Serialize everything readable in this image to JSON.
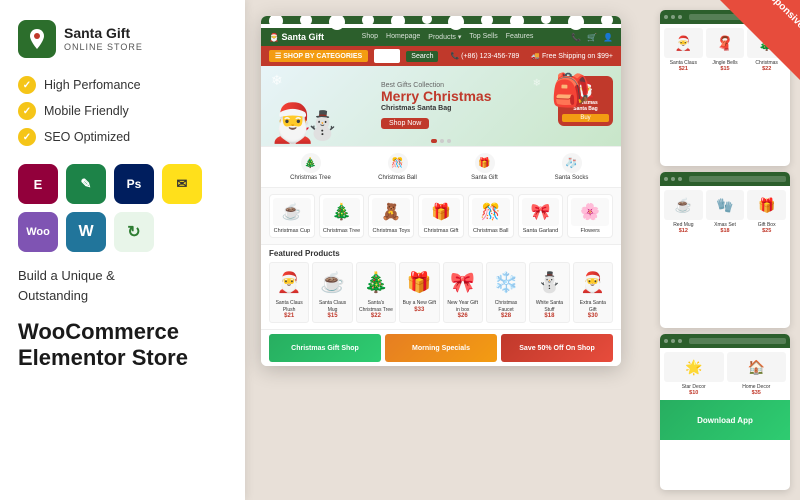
{
  "logo": {
    "title": "Santa Gift",
    "subtitle": "Online Store"
  },
  "features": [
    {
      "label": "High Perfomance"
    },
    {
      "label": "Mobile Friendly"
    },
    {
      "label": "SEO Optimized"
    }
  ],
  "plugins": [
    {
      "name": "elementor",
      "label": "E",
      "class": "pi-elementor"
    },
    {
      "name": "edit",
      "label": "✎",
      "class": "pi-edit"
    },
    {
      "name": "photoshop",
      "label": "Ps",
      "class": "pi-ps"
    },
    {
      "name": "mailchimp",
      "label": "✉",
      "class": "pi-mailchimp"
    },
    {
      "name": "woocommerce",
      "label": "Woo",
      "class": "pi-woo"
    },
    {
      "name": "wordpress",
      "label": "W",
      "class": "pi-wp"
    },
    {
      "name": "update",
      "label": "↻",
      "class": "pi-update"
    }
  ],
  "cta": {
    "line1": "Build a Unique &",
    "line2": "Outstanding",
    "line3": "WooCommerce",
    "line4": "Elementor Store"
  },
  "badge": {
    "label": "Responsive"
  },
  "shop": {
    "name": "Santa Gift",
    "nav_items": [
      "Shop",
      "Homepage",
      "Products",
      "Top Sells",
      "Features"
    ],
    "hero": {
      "small": "Best Gifts Collection",
      "title": "Merry Christmas",
      "subtitle": "Christmas Santa Bag",
      "button": "Shop Now"
    },
    "categories": [
      {
        "name": "Christmas Tree",
        "emoji": "🎄"
      },
      {
        "name": "Christmas Ball",
        "emoji": "🎊"
      },
      {
        "name": "Santa Gift",
        "emoji": "🎁"
      },
      {
        "name": "Santa Socks",
        "emoji": "🧦"
      }
    ],
    "product_cats": [
      {
        "name": "Christmas Cup",
        "emoji": "☕"
      },
      {
        "name": "Christmas Tree",
        "emoji": "🎄"
      },
      {
        "name": "Christmas Toys",
        "emoji": "🧸"
      },
      {
        "name": "Christmas Gift",
        "emoji": "🎁"
      },
      {
        "name": "Christmas Ball",
        "emoji": "🎊"
      },
      {
        "name": "Santa Garland",
        "emoji": "🎀"
      },
      {
        "name": "Flowers",
        "emoji": "🌸"
      }
    ],
    "featured_products": [
      {
        "name": "Santa Claus Plush",
        "price": "$21",
        "emoji": "🎅"
      },
      {
        "name": "Santa Claus Mug",
        "price": "$15",
        "emoji": "☕"
      },
      {
        "name": "Santa's Christmas Tree",
        "price": "$22",
        "emoji": "🎄"
      },
      {
        "name": "Buy a New Gift",
        "price": "$33",
        "emoji": "🎁"
      },
      {
        "name": "New Year Gift in box",
        "price": "$26",
        "emoji": "🎀"
      },
      {
        "name": "Christmas Faucet",
        "price": "$28",
        "emoji": "❄️"
      },
      {
        "name": "White Santa Stuff",
        "price": "$18",
        "emoji": "⛄"
      },
      {
        "name": "Extra Santa Gift",
        "price": "$30",
        "emoji": "🎅"
      }
    ],
    "bottom_banners": [
      {
        "label": "Christmas Gift Shop",
        "class": "bb-green"
      },
      {
        "label": "Morning Specials",
        "class": "bb-orange"
      },
      {
        "label": "Save 50% Off On Shop",
        "class": "bb-red"
      }
    ],
    "side_products": [
      {
        "emoji": "🎅",
        "name": "Santa Claus",
        "price": "$21"
      },
      {
        "emoji": "🧣",
        "name": "Jingle Bells",
        "price": "$15"
      },
      {
        "emoji": "🎄",
        "name": "Christmas",
        "price": "$22"
      },
      {
        "emoji": "☕",
        "name": "Red Mug",
        "price": "$12"
      },
      {
        "emoji": "🧤",
        "name": "Xmas Set",
        "price": "$18"
      },
      {
        "emoji": "🎁",
        "name": "Gift Box",
        "price": "$25"
      },
      {
        "emoji": "🌟",
        "name": "Star Decor",
        "price": "$10"
      },
      {
        "emoji": "🏠",
        "name": "Home Decor",
        "price": "$35"
      }
    ]
  }
}
